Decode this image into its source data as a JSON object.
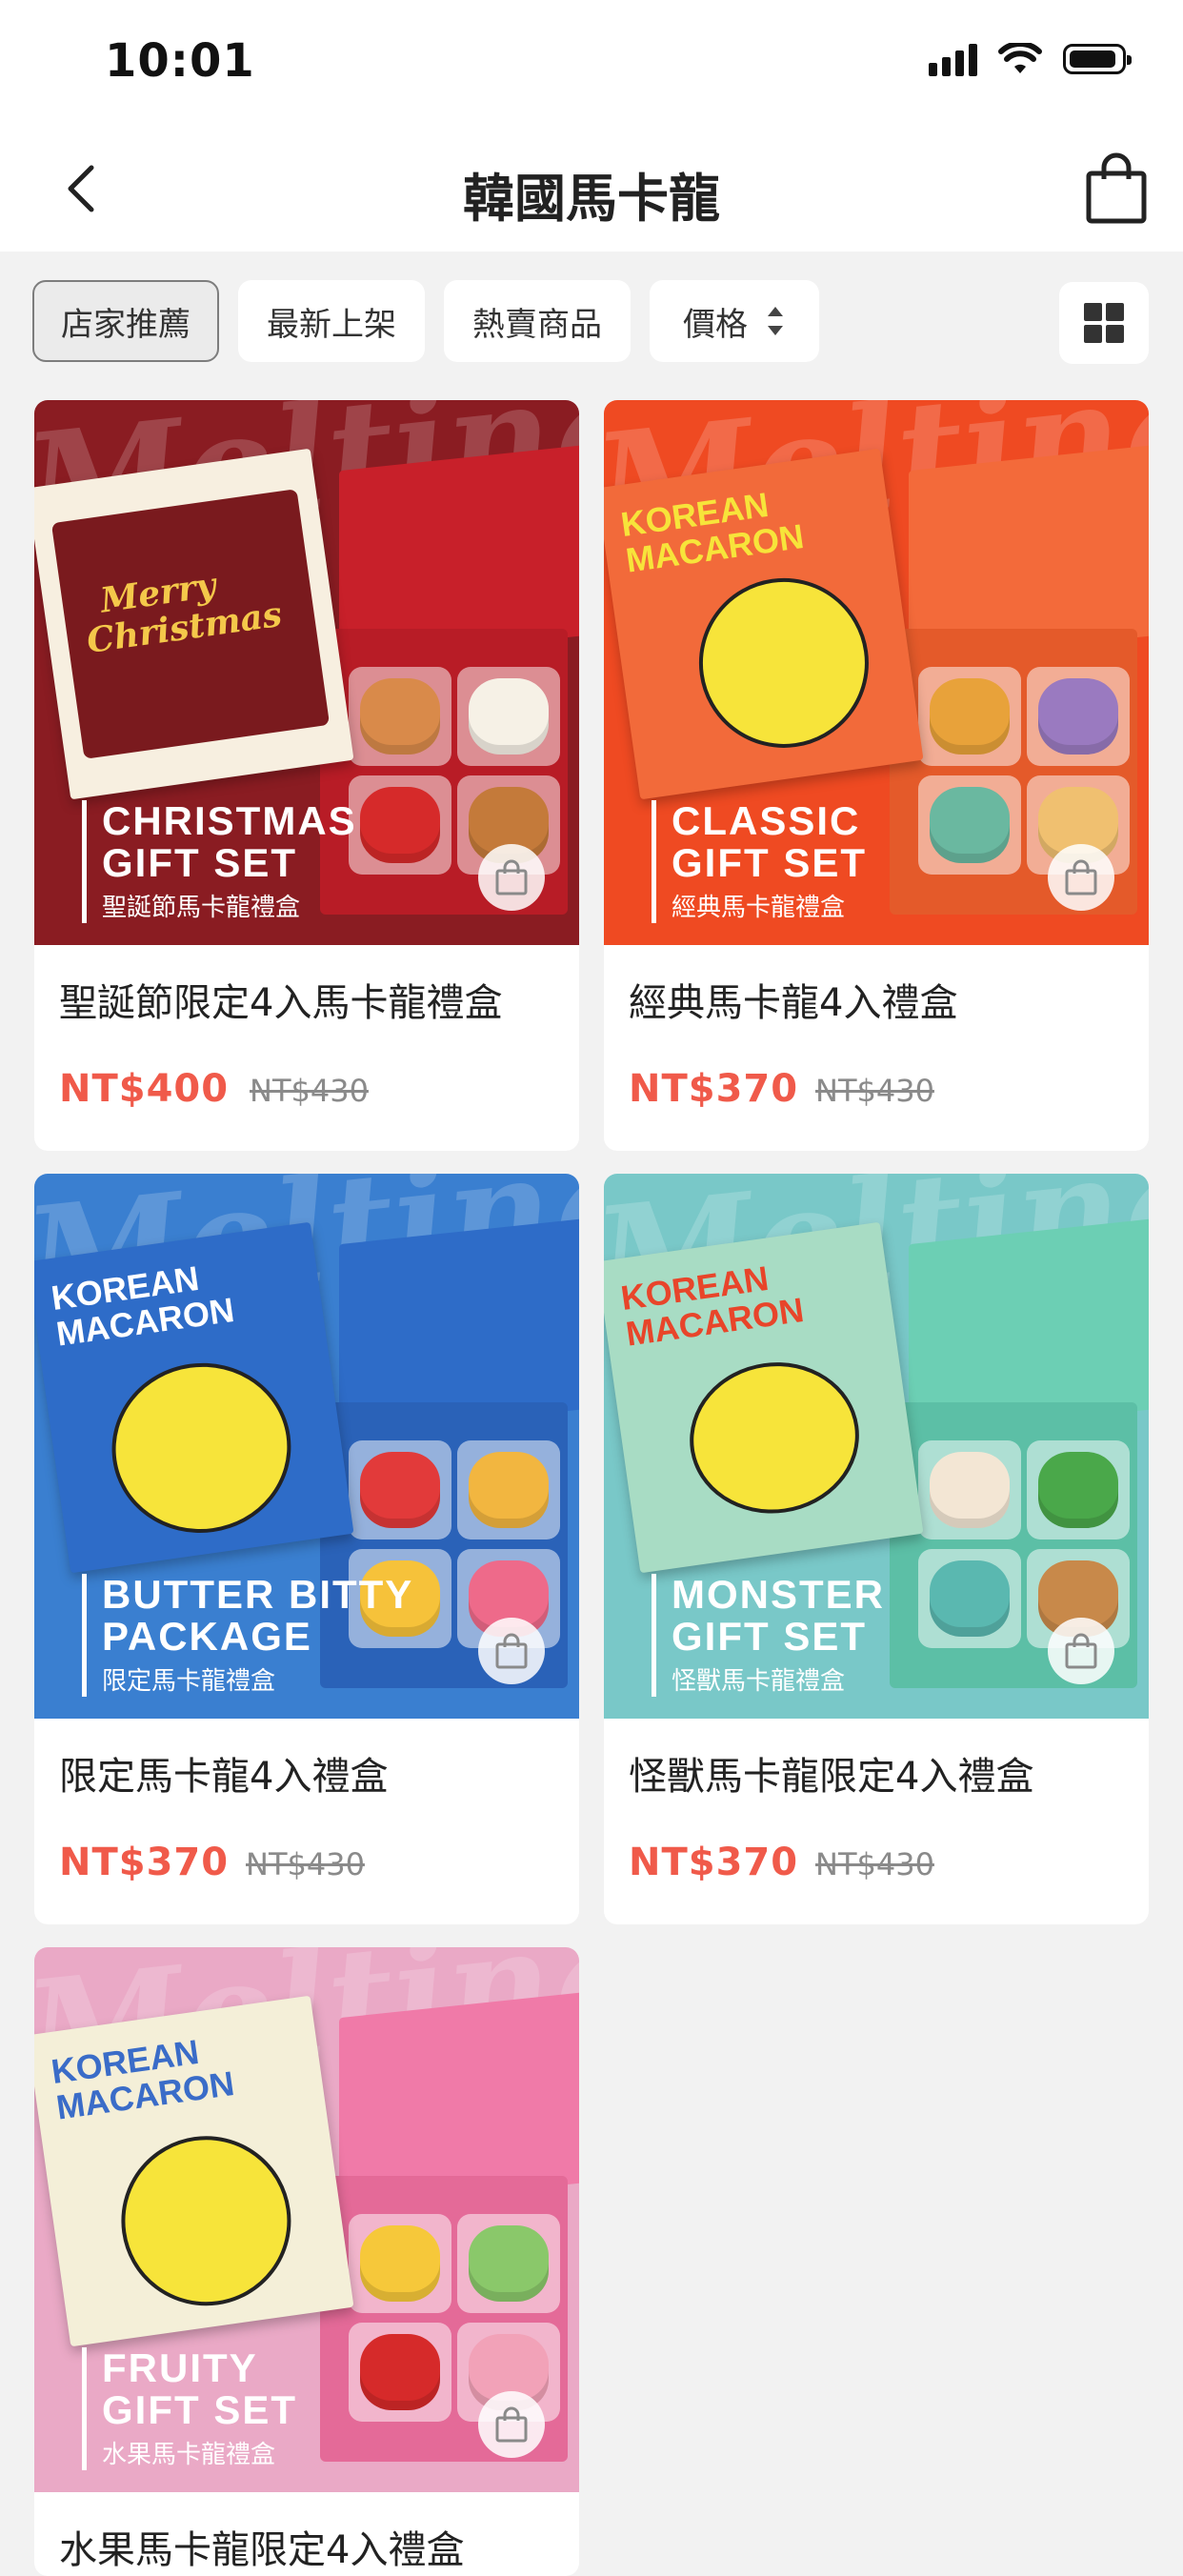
{
  "status_bar": {
    "time": "10:01"
  },
  "nav": {
    "title": "韓國馬卡龍"
  },
  "filters": [
    {
      "label": "店家推薦",
      "active": true
    },
    {
      "label": "最新上架",
      "active": false
    },
    {
      "label": "熱賣商品",
      "active": false
    },
    {
      "label": "價格",
      "active": false
    }
  ],
  "products": [
    {
      "name": "聖誕節限定4入馬卡龍禮盒",
      "price": "NT$400",
      "original_price": "NT$430",
      "banner_en_1": "CHRISTMAS",
      "banner_en_2": "GIFT SET",
      "banner_zh": "聖誕節馬卡龍禮盒",
      "box_text_1": "Merry",
      "box_text_2": "Christmas",
      "bg": "#8a1c22"
    },
    {
      "name": "經典馬卡龍4入禮盒",
      "price": "NT$370",
      "original_price": "NT$430",
      "banner_en_1": "CLASSIC",
      "banner_en_2": "GIFT SET",
      "banner_zh": "經典馬卡龍禮盒",
      "box_text_1": "KOREAN",
      "box_text_2": "MACARON",
      "bg": "#ef4a22"
    },
    {
      "name": "限定馬卡龍4入禮盒",
      "price": "NT$370",
      "original_price": "NT$430",
      "banner_en_1": "BUTTER BITTY",
      "banner_en_2": "PACKAGE",
      "banner_zh": "限定馬卡龍禮盒",
      "box_text_1": "KOREAN",
      "box_text_2": "MACARON",
      "bg": "#3a7fd0"
    },
    {
      "name": "怪獸馬卡龍限定4入禮盒",
      "price": "NT$370",
      "original_price": "NT$430",
      "banner_en_1": "MONSTER",
      "banner_en_2": "GIFT SET",
      "banner_zh": "怪獸馬卡龍禮盒",
      "box_text_1": "KOREAN",
      "box_text_2": "MACARON",
      "bg": "#79c8c8"
    },
    {
      "name": "水果馬卡龍限定4入禮盒",
      "price": "",
      "original_price": "",
      "banner_en_1": "FRUITY",
      "banner_en_2": "GIFT SET",
      "banner_zh": "水果馬卡龍禮盒",
      "box_text_1": "KOREAN",
      "box_text_2": "MACARON",
      "bg": "#eaa9c6"
    }
  ],
  "colors": {
    "accent_price": "#f05a4a",
    "page_bg": "#f2f2f2"
  },
  "icons": [
    "back-chevron-icon",
    "shopping-bag-icon",
    "sort-arrows-icon",
    "grid-view-icon",
    "add-to-bag-icon"
  ]
}
